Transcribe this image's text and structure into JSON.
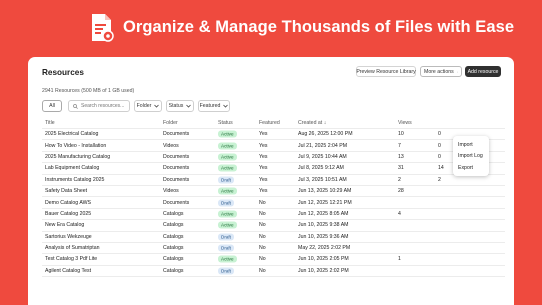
{
  "banner": {
    "title": "Organize & Manage Thousands of Files with Ease"
  },
  "header": {
    "title": "Resources",
    "preview_label": "Preview Resource Library",
    "more_label": "More actions",
    "add_label": "Add resource"
  },
  "subtitle": "2941 Resources (500 MB of 1 GB used)",
  "filters": {
    "all": "All",
    "search_placeholder": "Search resources...",
    "folder": "Folder",
    "status": "Status",
    "featured": "Featured"
  },
  "menu": {
    "items": [
      "Import",
      "Import Log",
      "Export"
    ]
  },
  "table": {
    "headers": [
      "Title",
      "Folder",
      "Status",
      "Featured",
      "Created at",
      "Views",
      ""
    ],
    "rows": [
      {
        "title": "2025 Electrical Catalog",
        "folder": "Documents",
        "status": "Active",
        "featured": "Yes",
        "created": "Aug 26, 2025 12:00 PM",
        "views": "10",
        "last": "0"
      },
      {
        "title": "How To Video - Installation",
        "folder": "Videos",
        "status": "Active",
        "featured": "Yes",
        "created": "Jul 21, 2025 2:04 PM",
        "views": "7",
        "last": "0"
      },
      {
        "title": "2025 Manufacturing Catalog",
        "folder": "Documents",
        "status": "Active",
        "featured": "Yes",
        "created": "Jul 9, 2025 10:44 AM",
        "views": "13",
        "last": "0"
      },
      {
        "title": "Lab Equipment Catalog",
        "folder": "Documents",
        "status": "Active",
        "featured": "Yes",
        "created": "Jul 8, 2025 9:12 AM",
        "views": "31",
        "last": "14"
      },
      {
        "title": "Instruments Catalog 2025",
        "folder": "Documents",
        "status": "Draft",
        "featured": "Yes",
        "created": "Jul 3, 2025 10:51 AM",
        "views": "2",
        "last": "2"
      },
      {
        "title": "Safety Data Sheet",
        "folder": "Videos",
        "status": "Active",
        "featured": "Yes",
        "created": "Jun 13, 2025 10:29 AM",
        "views": "28",
        "last": ""
      },
      {
        "title": "Demo Catalog AWS",
        "folder": "Documents",
        "status": "Draft",
        "featured": "No",
        "created": "Jun 12, 2025 12:21 PM",
        "views": "",
        "last": ""
      },
      {
        "title": "Bauer Catalog 2025",
        "folder": "Catalogs",
        "status": "Active",
        "featured": "No",
        "created": "Jun 12, 2025 8:05 AM",
        "views": "4",
        "last": ""
      },
      {
        "title": "New Era Catalog",
        "folder": "Catalogs",
        "status": "Active",
        "featured": "No",
        "created": "Jun 10, 2025 9:38 AM",
        "views": "",
        "last": ""
      },
      {
        "title": "Sartorius Wekzeuge",
        "folder": "Catalogs",
        "status": "Draft",
        "featured": "No",
        "created": "Jun 10, 2025 9:36 AM",
        "views": "",
        "last": ""
      },
      {
        "title": "Analysis of Sumatriptan",
        "folder": "Catalogs",
        "status": "Draft",
        "featured": "No",
        "created": "May 22, 2025 2:02 PM",
        "views": "",
        "last": ""
      },
      {
        "title": "Test Catalog 3 Pdf Lite",
        "folder": "Catalogs",
        "status": "Active",
        "featured": "No",
        "created": "Jun 10, 2025 2:05 PM",
        "views": "1",
        "last": ""
      },
      {
        "title": "Agilent Catalog Test",
        "folder": "Catalogs",
        "status": "Draft",
        "featured": "No",
        "created": "Jun 10, 2025 2:02 PM",
        "views": "",
        "last": ""
      }
    ]
  },
  "colors": {
    "brand": "#ef4a3e",
    "active_badge": "#c8f2d3",
    "draft_badge": "#dbe8f7"
  }
}
